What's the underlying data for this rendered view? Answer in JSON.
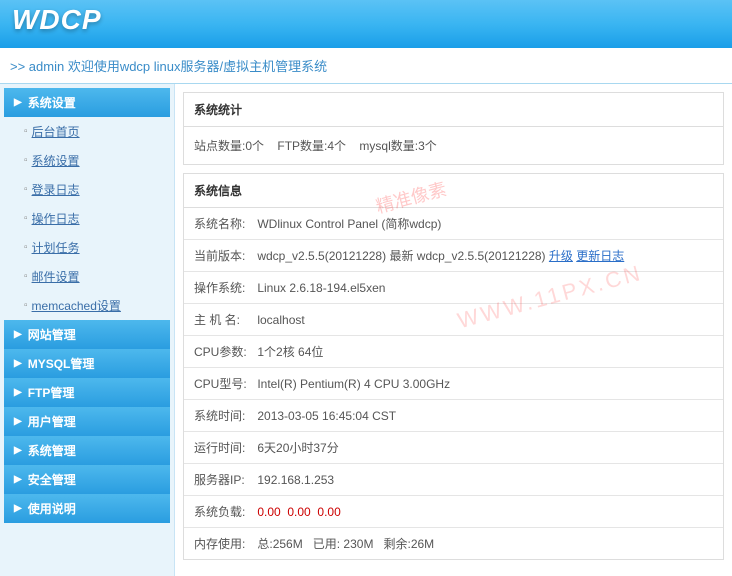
{
  "header": {
    "logo": "WDCP"
  },
  "breadcrumb": ">> admin 欢迎使用wdcp linux服务器/虚拟主机管理系统",
  "sidebar": {
    "sections": [
      {
        "label": "系统设置",
        "expanded": true,
        "items": [
          {
            "label": "后台首页"
          },
          {
            "label": "系统设置"
          },
          {
            "label": "登录日志"
          },
          {
            "label": "操作日志"
          },
          {
            "label": "计划任务"
          },
          {
            "label": "邮件设置"
          },
          {
            "label": "memcached设置"
          }
        ]
      },
      {
        "label": "网站管理",
        "expanded": false
      },
      {
        "label": "MYSQL管理",
        "expanded": false
      },
      {
        "label": "FTP管理",
        "expanded": false
      },
      {
        "label": "用户管理",
        "expanded": false
      },
      {
        "label": "系统管理",
        "expanded": false
      },
      {
        "label": "安全管理",
        "expanded": false
      },
      {
        "label": "使用说明",
        "expanded": false
      }
    ]
  },
  "stats": {
    "title": "系统统计",
    "site_label": "站点数量:",
    "site_count": "0个",
    "ftp_label": "FTP数量:",
    "ftp_count": "4个",
    "mysql_label": "mysql数量:",
    "mysql_count": "3个"
  },
  "sysinfo": {
    "title": "系统信息",
    "rows": {
      "name_label": "系统名称:",
      "name_value": "WDlinux Control Panel (简称wdcp)",
      "version_label": "当前版本:",
      "version_value": "wdcp_v2.5.5(20121228) 最新 wdcp_v2.5.5(20121228)",
      "upgrade_link": "升级",
      "changelog_link": "更新日志",
      "os_label": "操作系统:",
      "os_value": "Linux 2.6.18-194.el5xen",
      "host_label": "主 机 名:",
      "host_value": "localhost",
      "cpu_params_label": "CPU参数:",
      "cpu_params_value": "1个2核 64位",
      "cpu_model_label": "CPU型号:",
      "cpu_model_value": "Intel(R) Pentium(R) 4 CPU 3.00GHz",
      "systime_label": "系统时间:",
      "systime_value": "2013-03-05 16:45:04 CST",
      "uptime_label": "运行时间:",
      "uptime_value": "6天20小时37分",
      "ip_label": "服务器IP:",
      "ip_value": "192.168.1.253",
      "load_label": "系统负载:",
      "load_v1": "0.00",
      "load_v2": "0.00",
      "load_v3": "0.00",
      "mem_label": "内存使用:",
      "mem_total_label": "总:",
      "mem_total": "256M",
      "mem_used_label": "已用:",
      "mem_used": "230M",
      "mem_free_label": "剩余:",
      "mem_free": "26M"
    }
  },
  "watermark": {
    "text1": "精准像素",
    "text2": "WWW.11PX.CN"
  }
}
